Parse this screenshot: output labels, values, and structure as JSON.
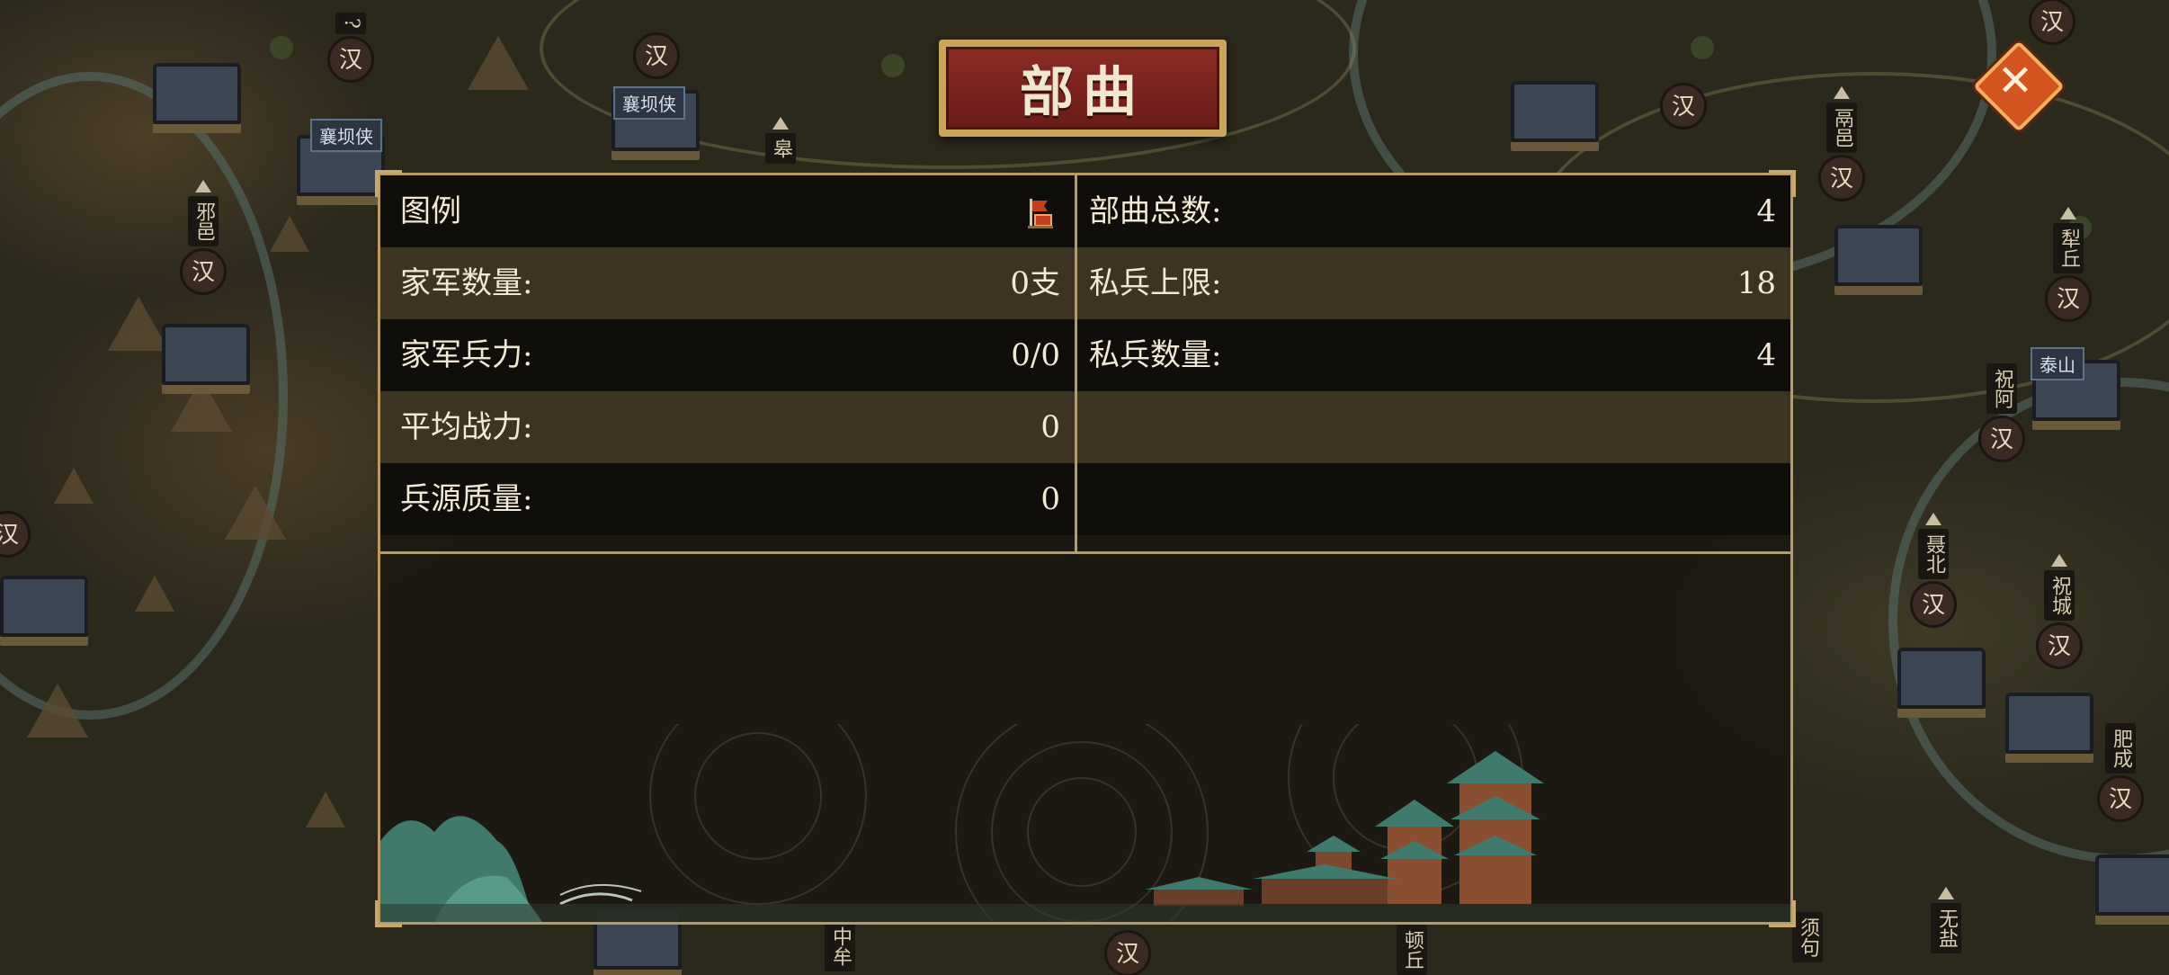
{
  "title": "部曲",
  "close_icon": "close-icon",
  "legend": {
    "label": "图例",
    "icon": "army-banner-icon"
  },
  "left_rows": [
    {
      "label": "家军数量:",
      "value": "0支"
    },
    {
      "label": "家军兵力:",
      "value": "0/0"
    },
    {
      "label": "平均战力:",
      "value": "0"
    },
    {
      "label": "兵源质量:",
      "value": "0"
    }
  ],
  "right_rows": [
    {
      "label": "部曲总数:",
      "value": "4"
    },
    {
      "label": "私兵上限:",
      "value": "18"
    },
    {
      "label": "私兵数量:",
      "value": "4"
    }
  ],
  "map": {
    "cities": [
      {
        "name": "邪邑",
        "seal": "汉"
      },
      {
        "name": "皋",
        "seal": "汉"
      },
      {
        "name": "?",
        "seal": "汉"
      },
      {
        "name": "鬲邑",
        "seal": "汉"
      },
      {
        "name": "犁丘",
        "seal": "汉"
      },
      {
        "name": "祝阿",
        "seal": "汉"
      },
      {
        "name": "聂北",
        "seal": "汉"
      },
      {
        "name": "祝城",
        "seal": "汉"
      },
      {
        "name": "肥成",
        "seal": "汉"
      },
      {
        "name": "无盐",
        "seal": ""
      },
      {
        "name": "须句",
        "seal": ""
      },
      {
        "name": "中牟",
        "seal": ""
      },
      {
        "name": "顿丘",
        "seal": ""
      }
    ],
    "banners": [
      "襄坝侠",
      "襄坝侠",
      "泰山"
    ],
    "seal_only": [
      "汉",
      "汉",
      "汉",
      "汉",
      "汉"
    ]
  }
}
